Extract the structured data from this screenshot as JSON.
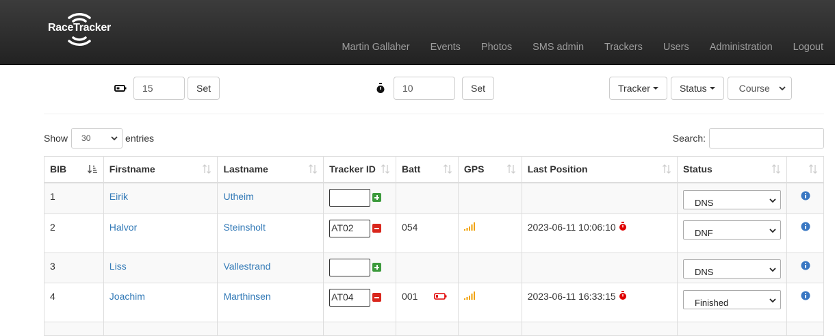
{
  "brand": {
    "name": "RaceTracker"
  },
  "nav": {
    "items": [
      "Martin Gallaher",
      "Events",
      "Photos",
      "SMS admin",
      "Trackers",
      "Users",
      "Administration",
      "Logout"
    ]
  },
  "controls": {
    "battery_value": "15",
    "battery_set_label": "Set",
    "timer_value": "10",
    "timer_set_label": "Set",
    "tracker_dropdown_label": "Tracker",
    "status_dropdown_label": "Status",
    "course_select_value": "Course"
  },
  "table_controls": {
    "show_label": "Show",
    "entries_value": "30",
    "entries_label": "entries",
    "search_label": "Search:"
  },
  "table": {
    "headers": [
      "BIB",
      "Firstname",
      "Lastname",
      "Tracker ID",
      "Batt",
      "GPS",
      "Last Position",
      "Status",
      ""
    ],
    "rows": [
      {
        "bib": "1",
        "firstname": "Eirik",
        "lastname": "Utheim",
        "tracker_id": "",
        "batt": "",
        "gps": false,
        "last_position": "",
        "status": "DNS"
      },
      {
        "bib": "2",
        "firstname": "Halvor",
        "lastname": "Steinsholt",
        "tracker_id": "AT02",
        "batt": "054",
        "gps": true,
        "last_position": "2023-06-11 10:06:10",
        "status": "DNF"
      },
      {
        "bib": "3",
        "firstname": "Liss",
        "lastname": "Vallestrand",
        "tracker_id": "",
        "batt": "",
        "gps": false,
        "last_position": "",
        "status": "DNS"
      },
      {
        "bib": "4",
        "firstname": "Joachim",
        "lastname": "Marthinsen",
        "tracker_id": "AT04",
        "batt": "001",
        "gps": true,
        "last_position": "2023-06-11 16:33:15",
        "status": "Finished"
      }
    ]
  },
  "colors": {
    "navbar_bg": "#222222",
    "nav_text": "#9d9d9d",
    "link": "#337ab7",
    "gps_signal": "#f0a000",
    "stopwatch_red": "#e00000",
    "add_green": "#3c9a3c",
    "remove_red": "#d9261c",
    "info_blue": "#3a78c3"
  },
  "icons": {
    "battery": "battery-icon",
    "timer": "stopwatch-icon",
    "sort": "sort-icon",
    "gps": "signal-bars-icon",
    "info": "info-icon"
  }
}
